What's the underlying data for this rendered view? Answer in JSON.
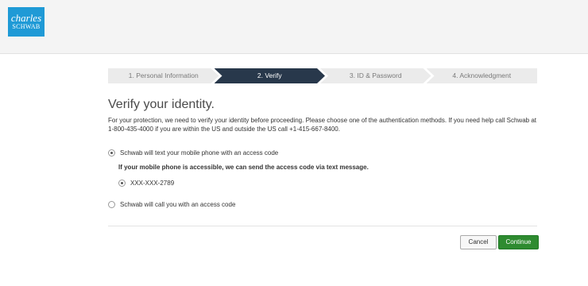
{
  "header": {
    "logo_line1": "charles",
    "logo_line2": "SCHWAB",
    "brand_color": "#1f9ad6"
  },
  "steps": [
    {
      "label": "1. Personal Information",
      "active": false
    },
    {
      "label": "2. Verify",
      "active": true
    },
    {
      "label": "3. ID & Password",
      "active": false
    },
    {
      "label": "4. Acknowledgment",
      "active": false
    }
  ],
  "main": {
    "title": "Verify your identity.",
    "intro": "For your protection, we need to verify your identity before proceeding. Please choose one of the authentication methods. If you need help call Schwab at 1-800-435-4000 if you are within the US and outside the US call +1-415-667-8400.",
    "option_text": "Schwab will text your mobile phone with an access code",
    "option_text_subtext": "If your mobile phone is accessible, we can send the access code via text message.",
    "phone_number": "XXX-XXX-2789",
    "option_call": "Schwab will call you with an access code"
  },
  "buttons": {
    "cancel": "Cancel",
    "continue": "Continue"
  },
  "colors": {
    "active_step": "#28384b",
    "continue_button": "#2e8b30"
  }
}
